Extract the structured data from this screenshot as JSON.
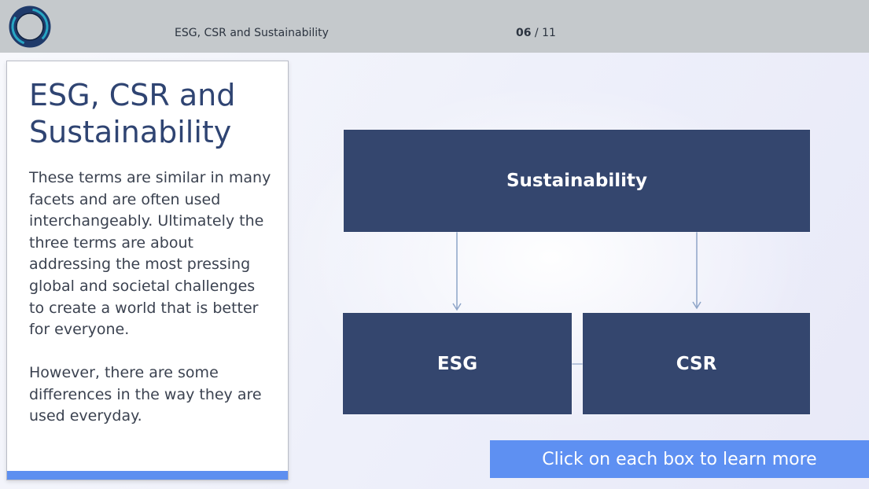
{
  "header": {
    "course_title": "ESG, CSR and Sustainability",
    "page_current": "06",
    "page_separator": " / ",
    "page_total": "11"
  },
  "card": {
    "title": "ESG, CSR and Sustainability",
    "paragraph_1": "These terms are similar in many facets and are often used interchangeably. Ultimately the three terms are about addressing the most pressing global and societal challenges to create a world that is better for everyone.",
    "paragraph_2": "However, there are some differences in the way they are used everyday."
  },
  "diagram": {
    "top_box": "Sustainability",
    "left_box": "ESG",
    "right_box": "CSR"
  },
  "cta": {
    "label": "Click on each box to learn more"
  },
  "colors": {
    "header_bg": "#c5c9cc",
    "box_fill": "#34466e",
    "accent_blue": "#5e90f2",
    "title_navy": "#2f4472",
    "connector": "#8ea5c8"
  },
  "icons": {
    "logo": "ring-logo-icon",
    "arrows": "arrow-down-icon"
  }
}
